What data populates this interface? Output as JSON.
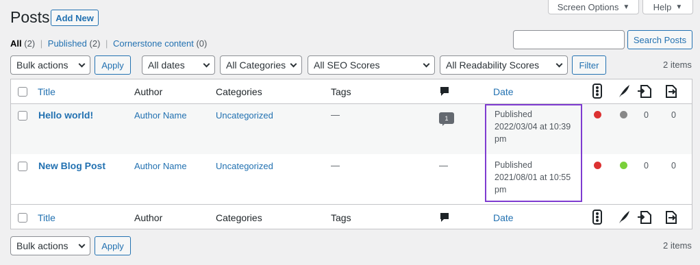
{
  "header": {
    "title": "Posts",
    "add_new": "Add New"
  },
  "screen_options": {
    "label": "Screen Options",
    "help": "Help"
  },
  "views": {
    "all": "All",
    "all_count": "(2)",
    "published": "Published",
    "published_count": "(2)",
    "cornerstone": "Cornerstone content",
    "cornerstone_count": "(0)"
  },
  "search": {
    "button": "Search Posts",
    "value": ""
  },
  "filters": {
    "bulk_actions": "Bulk actions",
    "apply": "Apply",
    "dates": "All dates",
    "categories": "All Categories",
    "seo": "All SEO Scores",
    "readability": "All Readability Scores",
    "filter": "Filter",
    "items": "2 items"
  },
  "columns": {
    "title": "Title",
    "author": "Author",
    "categories": "Categories",
    "tags": "Tags",
    "date": "Date"
  },
  "rows": [
    {
      "title": "Hello world!",
      "author": "Author Name",
      "category": "Uncategorized",
      "tags": "—",
      "comments": "1",
      "date_status": "Published",
      "date_line1": "2022/03/04 at 10:39",
      "date_line2": "pm",
      "seo_color": "#dc3232",
      "readability_color": "#888888",
      "links_out": "0",
      "links_in": "0"
    },
    {
      "title": "New Blog Post",
      "author": "Author Name",
      "category": "Uncategorized",
      "tags": "—",
      "comments": "—",
      "date_status": "Published",
      "date_line1": "2021/08/01 at 10:55",
      "date_line2": "pm",
      "seo_color": "#dc3232",
      "readability_color": "#7ad03a",
      "links_out": "0",
      "links_in": "0"
    }
  ],
  "footer": {
    "bulk_actions": "Bulk actions",
    "apply": "Apply",
    "items": "2 items"
  },
  "icons": {
    "comment": "comment-icon",
    "seo": "seo-score-icon",
    "readability": "readability-feather-icon",
    "outgoing": "outgoing-links-icon",
    "incoming": "incoming-links-icon"
  }
}
